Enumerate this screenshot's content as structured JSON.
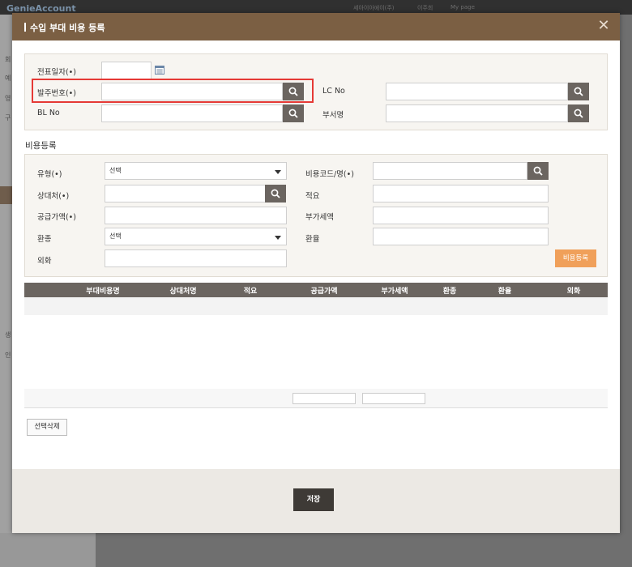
{
  "background": {
    "logo": "GenieAccount",
    "user": "세아이아에이(주)",
    "user2": "이주희",
    "mypage": "My page",
    "sidebar_items": [
      "회",
      "예",
      "영",
      "구",
      "생",
      "인"
    ]
  },
  "modal": {
    "title": "수입 부대 비용 등록",
    "close_glyph": "✕"
  },
  "top_form": {
    "voucher_date_label": "전표일자(•)",
    "order_no_label": "발주번호(•)",
    "lc_no_label": "LC No",
    "bl_no_label": "BL No",
    "dept_label": "부서명"
  },
  "cost_section": {
    "title": "비용등록",
    "type_label": "유형(•)",
    "type_value": "선택",
    "cost_code_label": "비용코드/명(•)",
    "counterparty_label": "상대처(•)",
    "summary_label": "적요",
    "supply_amount_label": "공급가액(•)",
    "vat_label": "부가세액",
    "currency_label": "환종",
    "currency_value": "선택",
    "exchange_rate_label": "환율",
    "foreign_label": "외화",
    "register_button": "비용등록"
  },
  "grid": {
    "columns": [
      "부대비용명",
      "상대처명",
      "적요",
      "공급가액",
      "부가세액",
      "환종",
      "환율",
      "외화"
    ]
  },
  "delete_button": "선택삭제",
  "save_button": "저장"
}
